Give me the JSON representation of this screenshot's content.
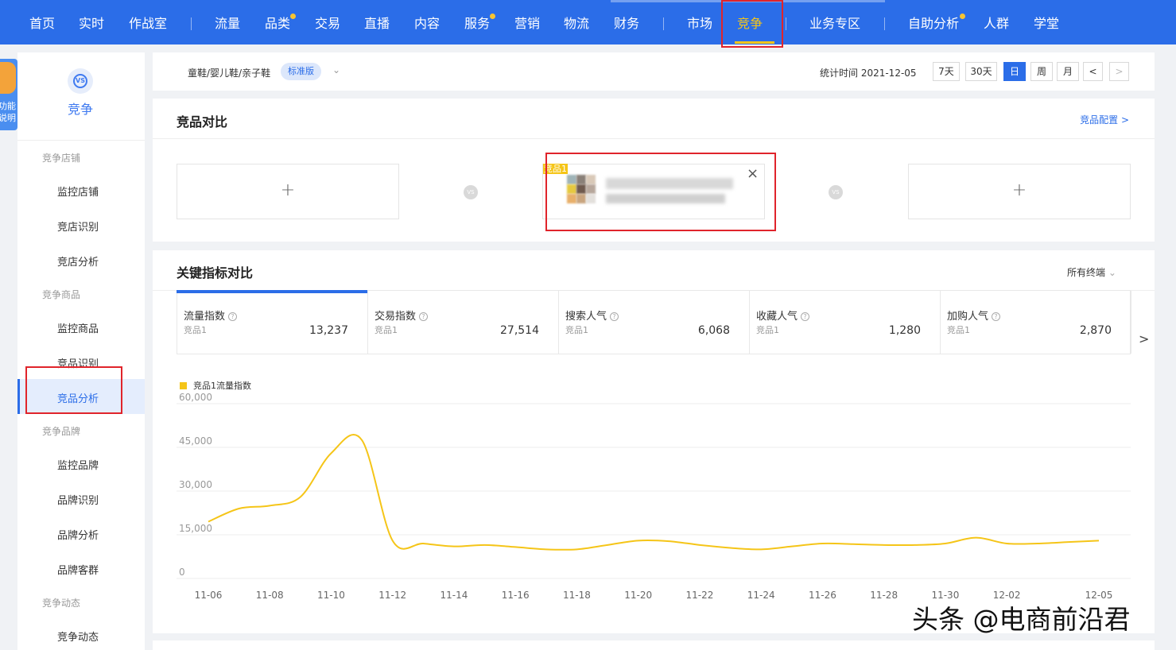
{
  "topnav": {
    "items": [
      "首页",
      "实时",
      "作战室",
      "流量",
      "品类",
      "交易",
      "直播",
      "内容",
      "服务",
      "营销",
      "物流",
      "财务",
      "市场",
      "竞争",
      "业务专区",
      "自助分析",
      "人群",
      "学堂"
    ],
    "active": "竞争",
    "accent": "#2b6de8",
    "active_color": "#f5c518",
    "badge_dots_on": [
      "品类",
      "服务",
      "自助分析"
    ]
  },
  "help": {
    "label": "功能说明"
  },
  "sidebar": {
    "title": "竞争",
    "icon": "vs-icon",
    "groups": [
      {
        "label": "竞争店铺",
        "items": [
          "监控店铺",
          "竞店识别",
          "竞店分析"
        ]
      },
      {
        "label": "竞争商品",
        "items": [
          "监控商品",
          "竞品识别",
          "竞品分析"
        ]
      },
      {
        "label": "竞争品牌",
        "items": [
          "监控品牌",
          "品牌识别",
          "品牌分析",
          "品牌客群"
        ]
      },
      {
        "label": "竞争动态",
        "items": [
          "竞争动态"
        ]
      }
    ],
    "active_item": "竞品分析"
  },
  "toolbar": {
    "category": "童鞋/婴儿鞋/亲子鞋",
    "edition": "标准版",
    "stat_time": "统计时间 2021-12-05",
    "ranges": [
      "7天",
      "30天",
      "日",
      "周",
      "月"
    ],
    "active_range": "日",
    "prev": "<",
    "next": ">"
  },
  "compare": {
    "title": "竞品对比",
    "config_link": "竞品配置 >",
    "vs": "VS",
    "add": "+",
    "product_tag": "竞品1",
    "close": "×"
  },
  "metrics": {
    "title": "关键指标对比",
    "filter": "所有终端",
    "help_icon": "?",
    "next_icon": ">",
    "tabs": [
      {
        "name": "流量指数",
        "sub": "竞品1",
        "value": "13,237"
      },
      {
        "name": "交易指数",
        "sub": "竞品1",
        "value": "27,514"
      },
      {
        "name": "搜索人气",
        "sub": "竞品1",
        "value": "6,068"
      },
      {
        "name": "收藏人气",
        "sub": "竞品1",
        "value": "1,280"
      },
      {
        "name": "加购人气",
        "sub": "竞品1",
        "value": "2,870"
      }
    ]
  },
  "chart_data": {
    "type": "line",
    "x": [
      "11-06",
      "11-07",
      "11-08",
      "11-09",
      "11-10",
      "11-11",
      "11-12",
      "11-13",
      "11-14",
      "11-15",
      "11-16",
      "11-17",
      "11-18",
      "11-19",
      "11-20",
      "11-21",
      "11-22",
      "11-23",
      "11-24",
      "11-25",
      "11-26",
      "11-27",
      "11-28",
      "11-29",
      "11-30",
      "12-01",
      "12-02",
      "12-03",
      "12-04",
      "12-05"
    ],
    "x_tick_labels": [
      "11-06",
      "11-08",
      "11-10",
      "11-12",
      "11-14",
      "11-16",
      "11-18",
      "11-20",
      "11-22",
      "11-24",
      "11-26",
      "11-28",
      "11-30",
      "12-02",
      "12-05"
    ],
    "series": [
      {
        "name": "竞品1流量指数",
        "color": "#f5c518",
        "values": [
          19500,
          24000,
          25000,
          28000,
          43000,
          47500,
          13000,
          12000,
          11000,
          11500,
          10800,
          10000,
          10000,
          11500,
          13000,
          12800,
          11500,
          10500,
          10000,
          11000,
          12000,
          11800,
          11500,
          11500,
          12000,
          14000,
          12000,
          12000,
          12500,
          13000
        ]
      }
    ],
    "y_ticks": [
      "0",
      "15,000",
      "30,000",
      "45,000",
      "60,000"
    ],
    "ylim": [
      0,
      60000
    ],
    "grid": true,
    "legend": "top-left"
  },
  "watermark": "头条 @电商前沿君"
}
